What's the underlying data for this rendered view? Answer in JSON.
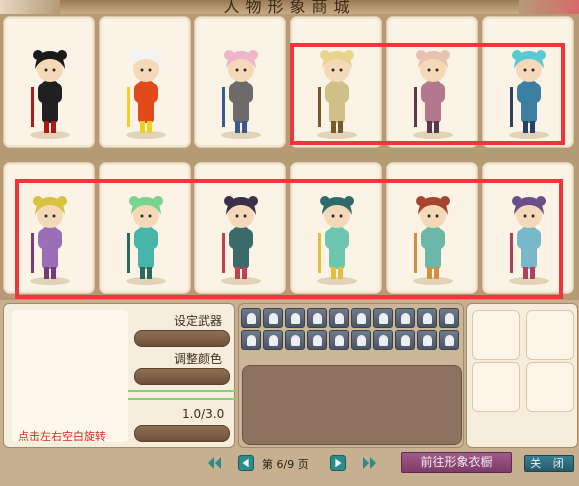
{
  "window": {
    "title": "人物形象商城"
  },
  "avatars": [
    {
      "id": "dark-swordsman",
      "hair": "#1a1a1a",
      "body": "#202020",
      "accent": "#b01818"
    },
    {
      "id": "white-red-warrior",
      "hair": "#f3f3f3",
      "body": "#e24a1c",
      "accent": "#f0d020"
    },
    {
      "id": "pink-hair-warrior",
      "hair": "#f0b5c8",
      "body": "#6e6a6a",
      "accent": "#3a5a8a"
    },
    {
      "id": "blonde-bun-girl",
      "hair": "#e6d58a",
      "body": "#cfc089",
      "accent": "#7a5a2a"
    },
    {
      "id": "pink-bun-girl",
      "hair": "#e8c2b0",
      "body": "#b3788c",
      "accent": "#5a3a4a"
    },
    {
      "id": "cyan-bun-girl",
      "hair": "#5bc9d4",
      "body": "#3d7fa0",
      "accent": "#2a3f6a"
    },
    {
      "id": "violet-bun-girl",
      "hair": "#d9c23f",
      "body": "#9b6fb8",
      "accent": "#7a3a7a"
    },
    {
      "id": "green-bun-girl",
      "hair": "#78d48f",
      "body": "#47b6a8",
      "accent": "#2a6a5a"
    },
    {
      "id": "dark-hair-maiden",
      "hair": "#3a3048",
      "body": "#3b6b6b",
      "accent": "#c04050"
    },
    {
      "id": "teal-dress-maiden",
      "hair": "#2f6b6b",
      "body": "#6dc7b0",
      "accent": "#e0c040"
    },
    {
      "id": "auburn-hair-maiden",
      "hair": "#a6452f",
      "body": "#6bb8a8",
      "accent": "#d09040"
    },
    {
      "id": "purple-hair-maiden",
      "hair": "#6a4f8a",
      "body": "#78b8c8",
      "accent": "#b04060"
    }
  ],
  "controls": {
    "set_weapon": "设定武器",
    "adjust_color": "调整颜色",
    "zoom_value": "1.0/3.0",
    "rotate_hint": "点击左右空白旋转"
  },
  "pager": {
    "text": "第 6/9 页"
  },
  "buttons": {
    "wardrobe": "前往形象衣橱",
    "close": "关 闭"
  },
  "actions_count": 20,
  "colors": {
    "selection": "#f0353b",
    "wardrobe_btn": "#8a4574",
    "close_btn": "#2f6d80"
  }
}
